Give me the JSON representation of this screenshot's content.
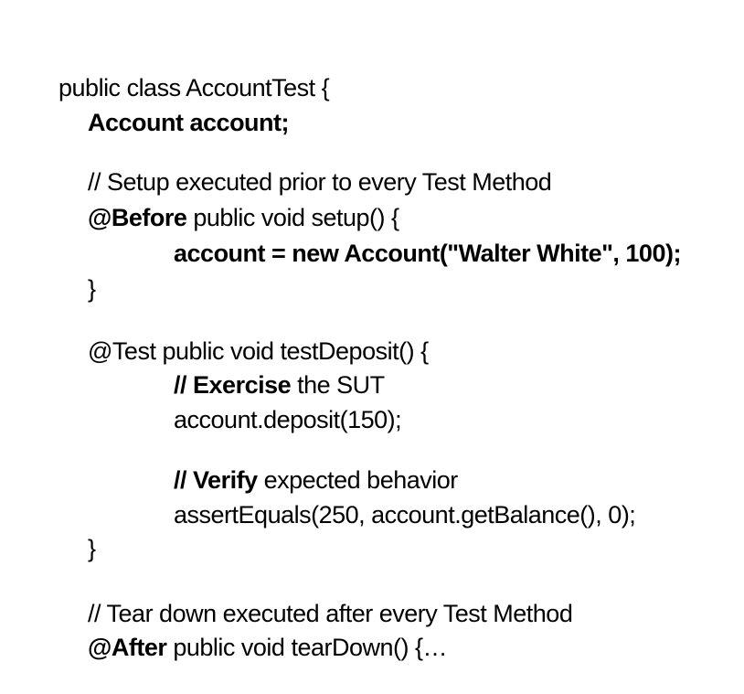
{
  "code": {
    "class_decl": "public class AccountTest {",
    "field_decl": "Account account;",
    "setup_comment": "// Setup executed prior to every Test Method",
    "before_annotation": "@Before",
    "setup_signature": " public void setup() {",
    "account_assign": "account = new Account(\"Walter White\", 100);",
    "close_brace_1": "}",
    "test_annotation_signature": "@Test public void testDeposit() {",
    "exercise_comment_prefix": "// ",
    "exercise_word": "Exercise",
    "exercise_comment_rest": " the SUT",
    "deposit_call": "account.deposit(150);",
    "verify_comment_prefix": "// ",
    "verify_word": "Verify",
    "verify_comment_rest": " expected behavior",
    "assert_call": "assertEquals(250, account.getBalance(), 0);",
    "close_brace_2": "}",
    "teardown_comment": "// Tear down executed after every Test Method",
    "after_annotation": "@After",
    "teardown_signature": " public void tearDown() {…"
  }
}
